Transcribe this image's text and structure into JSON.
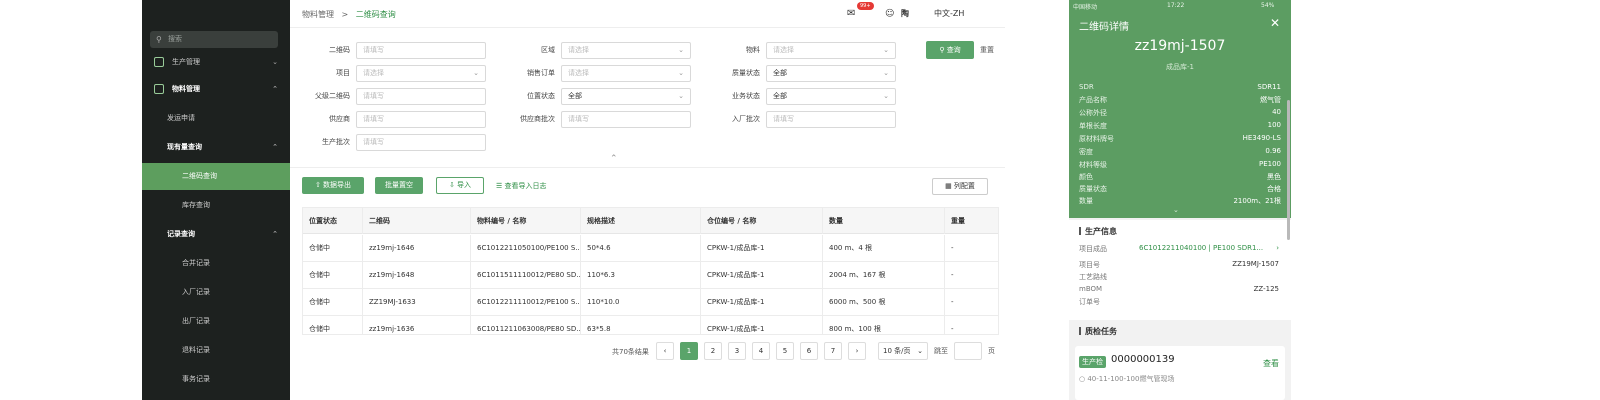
{
  "sidebar": {
    "search_placeholder": "搜索",
    "items": [
      {
        "label": "生产管理"
      },
      {
        "label": "物料管理"
      },
      {
        "label": "发运申请"
      },
      {
        "label": "现有量查询"
      },
      {
        "label": "二维码查询"
      },
      {
        "label": "库存查询"
      },
      {
        "label": "记录查询"
      },
      {
        "label": "合并记录"
      },
      {
        "label": "入厂记录"
      },
      {
        "label": "出厂记录"
      },
      {
        "label": "退料记录"
      },
      {
        "label": "事务记录"
      }
    ]
  },
  "header": {
    "breadcrumb_parent": "物料管理",
    "breadcrumb_sep": ">",
    "breadcrumb_current": "二维码查询",
    "badge": "99+",
    "user": "陶",
    "lang": "中文-ZH"
  },
  "form": {
    "fields": [
      {
        "label": "二维码",
        "value": "请填写"
      },
      {
        "label": "区域",
        "value": "请选择"
      },
      {
        "label": "物料",
        "value": "请选择"
      },
      {
        "label": "项目",
        "value": "请选择"
      },
      {
        "label": "销售订单",
        "value": "请选择"
      },
      {
        "label": "质量状态",
        "value": "全部"
      },
      {
        "label": "父级二维码",
        "value": "请填写"
      },
      {
        "label": "位置状态",
        "value": "全部"
      },
      {
        "label": "业务状态",
        "value": "全部"
      },
      {
        "label": "供应商",
        "value": "请填写"
      },
      {
        "label": "供应商批次",
        "value": "请填写"
      },
      {
        "label": "入厂批次",
        "value": "请填写"
      },
      {
        "label": "生产批次",
        "value": "请填写"
      }
    ],
    "query_label": "查询",
    "reset_label": "重置",
    "collapse_icon": "chevron-up-icon"
  },
  "toolbar": {
    "export_label": "数据导出",
    "batch_label": "批量置空",
    "import_label": "导入",
    "log_label": "查看导入日志",
    "columns_label": "列配置"
  },
  "table": {
    "headers": [
      "位置状态",
      "二维码",
      "物料编号 / 名称",
      "规格描述",
      "仓位编号 / 名称",
      "数量",
      "重量"
    ],
    "rows": [
      [
        "仓储中",
        "zz19mj-1646",
        "6C1012211050100/PE100 S...",
        "50*4.6",
        "CPKW-1/成品库-1",
        "400 m、4 根",
        "-"
      ],
      [
        "仓储中",
        "zz19mj-1648",
        "6C1011511110012/PE80 SD...",
        "110*6.3",
        "CPKW-1/成品库-1",
        "2004 m、167 根",
        "-"
      ],
      [
        "仓储中",
        "ZZ19MJ-1633",
        "6C1012211110012/PE100 S...",
        "110*10.0",
        "CPKW-1/成品库-1",
        "6000 m、500 根",
        "-"
      ],
      [
        "仓储中",
        "zz19mj-1636",
        "6C1011211063008/PE80 SD...",
        "63*5.8",
        "CPKW-1/成品库-1",
        "800 m、100 根",
        "-"
      ]
    ]
  },
  "pagination": {
    "total": "共70条结果",
    "pages": [
      "1",
      "2",
      "3",
      "4",
      "5",
      "6",
      "7"
    ],
    "current": "1",
    "page_size": "10 条/页",
    "goto_label": "跳至",
    "page_suffix": "页"
  },
  "mobile": {
    "carrier": "中国移动",
    "time": "17:22",
    "battery": "54%",
    "title": "二维码详情",
    "code": "zz19mj-1507",
    "location": "成品库-1",
    "props": [
      {
        "k": "SDR",
        "v": "SDR11"
      },
      {
        "k": "产品名称",
        "v": "燃气管"
      },
      {
        "k": "公称外径",
        "v": "40"
      },
      {
        "k": "单根长度",
        "v": "100"
      },
      {
        "k": "原材料牌号",
        "v": "HE3490-LS"
      },
      {
        "k": "密度",
        "v": "0.96"
      },
      {
        "k": "材料等级",
        "v": "PE100"
      },
      {
        "k": "颜色",
        "v": "黑色"
      },
      {
        "k": "质量状态",
        "v": "合格"
      },
      {
        "k": "数量",
        "v": "2100m、21根"
      }
    ],
    "production_title": "生产信息",
    "production": [
      {
        "k": "项目成品",
        "v": "6C1012211040100 | PE100 SDR1..."
      },
      {
        "k": "项目号",
        "v": "ZZ19MJ-1507"
      },
      {
        "k": "工艺路线",
        "v": ""
      },
      {
        "k": "mBOM",
        "v": "ZZ-125"
      },
      {
        "k": "订单号",
        "v": ""
      }
    ],
    "qc_title": "质检任务",
    "qc_tag": "生产检",
    "qc_code": "0000000139",
    "qc_view": "查看",
    "qc_desc": "40-11-100-100燃气管现场"
  },
  "colors": {
    "accent": "#5aa46a",
    "sidebar": "#1d211f",
    "phone_header": "#5c9d62"
  }
}
